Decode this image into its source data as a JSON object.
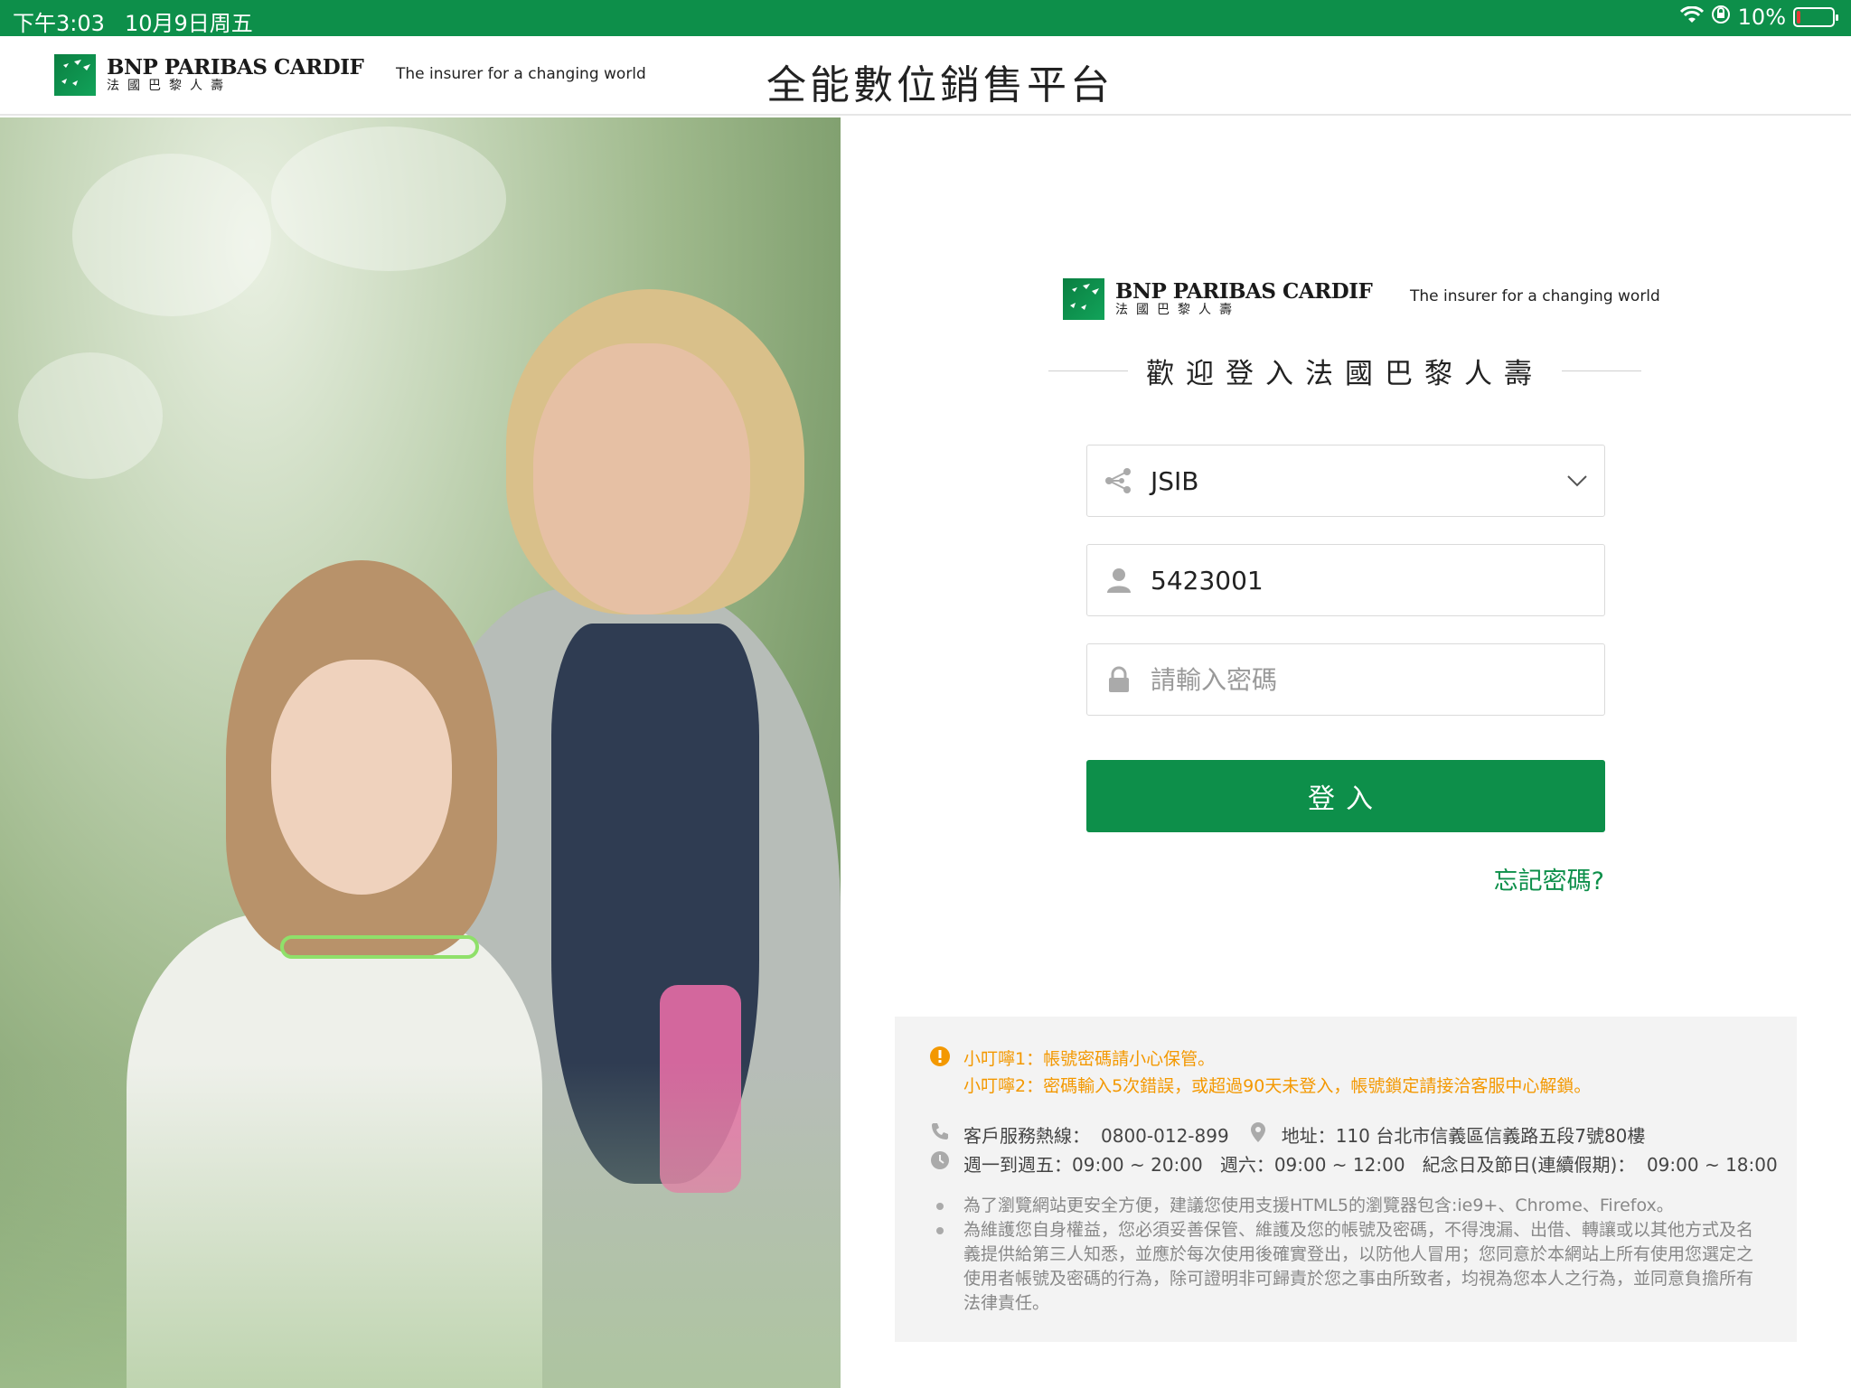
{
  "status_bar": {
    "time": "下午3:03",
    "date": "10月9日周五",
    "battery_percent": "10%",
    "battery_level": 0.1,
    "icons": [
      "wifi-icon",
      "orientation-lock-icon",
      "battery-charging-icon"
    ]
  },
  "header": {
    "brand": "BNP PARIBAS CARDIF",
    "brand_cn": "法國巴黎人壽",
    "tagline": "The insurer for a changing world",
    "platform_title": "全能數位銷售平台"
  },
  "login": {
    "brand": "BNP PARIBAS CARDIF",
    "brand_cn": "法國巴黎人壽",
    "tagline": "The insurer for a changing world",
    "welcome": "歡迎登入法國巴黎人壽",
    "channel_value": "JSIB",
    "account_value": "5423001",
    "password_placeholder": "請輸入密碼",
    "login_button": "登入",
    "forgot_link": "忘記密碼?"
  },
  "notice": {
    "tip1": "小叮嚀1：帳號密碼請小心保管。",
    "tip2": "小叮嚀2：密碼輸入5次錯誤，或超過90天未登入，帳號鎖定請接洽客服中心解鎖。",
    "hotline_label": "客戶服務熱線：",
    "hotline": "0800-012-899",
    "address_label": "地址：",
    "address": "110 台北市信義區信義路五段7號80樓",
    "hours": "週一到週五：09:00 ~ 20:00   週六：09:00 ~ 12:00   紀念日及節日(連續假期)：  09:00 ~ 18:00",
    "browser_note": "為了瀏覽網站更安全方便，建議您使用支援HTML5的瀏覽器包含:ie9+、Chrome、Firefox。",
    "rights_note": "為維護您自身權益，您必須妥善保管、維護及您的帳號及密碼，不得洩漏、出借、轉讓或以其他方式及名義提供給第三人知悉，並應於每次使用後確實登出，以防他人冒用；您同意於本網站上所有使用您選定之使用者帳號及密碼的行為，除可證明非可歸責於您之事由所致者，均視為您本人之行為，並同意負擔所有法律責任。"
  },
  "colors": {
    "brand_green": "#0d8f4a",
    "warning_orange": "#f39800"
  }
}
